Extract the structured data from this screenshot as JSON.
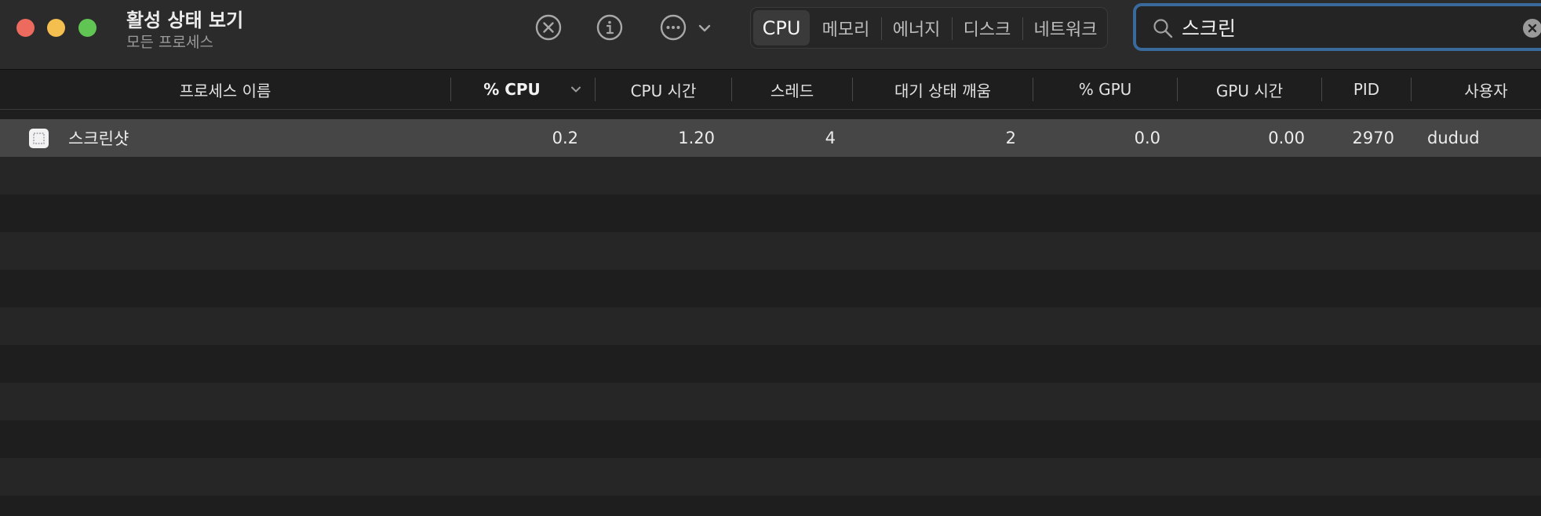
{
  "window": {
    "title": "활성 상태 보기",
    "subtitle": "모든 프로세스",
    "traffic_lights": [
      "close",
      "minimize",
      "zoom"
    ]
  },
  "toolbar": {
    "buttons": [
      {
        "name": "stop-process",
        "icon": "x-circle-icon"
      },
      {
        "name": "inspect-process",
        "icon": "info-circle-icon"
      },
      {
        "name": "more-actions",
        "icon": "ellipsis-circle-icon",
        "has_menu": true
      }
    ],
    "tabs": [
      {
        "label": "CPU",
        "active": true
      },
      {
        "label": "메모리",
        "active": false
      },
      {
        "label": "에너지",
        "active": false
      },
      {
        "label": "디스크",
        "active": false
      },
      {
        "label": "네트워크",
        "active": false
      }
    ]
  },
  "search": {
    "value": "스크린",
    "icon": "magnifier-icon",
    "clear_icon": "clear-circle-icon"
  },
  "table": {
    "columns": [
      {
        "key": "name",
        "label": "프로세스 이름"
      },
      {
        "key": "cpu",
        "label": "% CPU",
        "sorted": true,
        "sort_direction": "descending"
      },
      {
        "key": "cpu_time",
        "label": "CPU 시간"
      },
      {
        "key": "threads",
        "label": "스레드"
      },
      {
        "key": "idle_wakeups",
        "label": "대기 상태 깨움"
      },
      {
        "key": "gpu",
        "label": "% GPU"
      },
      {
        "key": "gpu_time",
        "label": "GPU 시간"
      },
      {
        "key": "pid",
        "label": "PID"
      },
      {
        "key": "user",
        "label": "사용자"
      }
    ],
    "rows": [
      {
        "name": "스크린샷",
        "cpu": "0.2",
        "cpu_time": "1.20",
        "threads": "4",
        "idle_wakeups": "2",
        "gpu": "0.0",
        "gpu_time": "0.00",
        "pid": "2970",
        "user": "dudud",
        "selected": true
      }
    ]
  },
  "colors": {
    "window_bg": "#1e1e1e",
    "toolbar_bg": "#2b2b2b",
    "row_stripe": "#262626",
    "row_selected": "#464646",
    "search_focus_ring": "#3a6a9c",
    "traffic_close": "#ed6a5e",
    "traffic_minimize": "#f5bf4f",
    "traffic_zoom": "#61c554"
  }
}
